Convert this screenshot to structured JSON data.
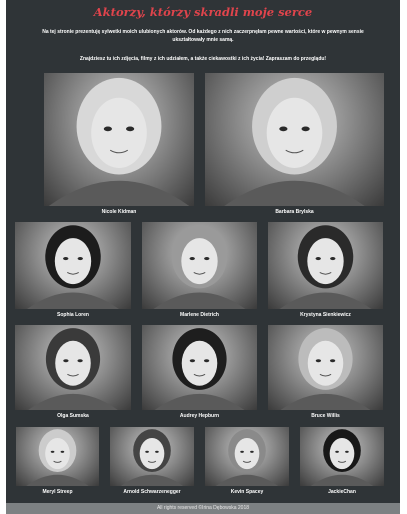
{
  "header": {
    "title": "Aktorzy, którzy skradli moje serce",
    "intro_line_1": "Na tej stronie prezentuję sylwetki moich ulubionych aktorów. Od każdego z nich zaczerpnęłam pewne wartości, które w pewnym sensie ukształtowały mnie samą.",
    "intro_line_2": "Znajdziesz tu ich zdjęcia, filmy z ich udziałem, a także ciekawostki z ich życia! Zapraszam do przeglądu!"
  },
  "actors": [
    {
      "name": "Nicole Kidman",
      "icon": "portrait-photo",
      "hair": "#d8d8d8"
    },
    {
      "name": "Barbara Brylska",
      "icon": "portrait-photo",
      "hair": "#cfcfcf"
    },
    {
      "name": "Sophia Loren",
      "icon": "portrait-photo",
      "hair": "#1c1c1c"
    },
    {
      "name": "Marlene Dietrich",
      "icon": "portrait-photo",
      "hair": "#9a9a9a"
    },
    {
      "name": "Krystyna Sienkiewicz",
      "icon": "portrait-photo",
      "hair": "#2a2a2a"
    },
    {
      "name": "Olga Sumska",
      "icon": "portrait-photo",
      "hair": "#3a3a3a"
    },
    {
      "name": "Audrey Hepburn",
      "icon": "portrait-photo",
      "hair": "#1e1e1e"
    },
    {
      "name": "Bruce Willis",
      "icon": "portrait-photo",
      "hair": "#bcbcbc"
    },
    {
      "name": "Meryl Streep",
      "icon": "portrait-photo",
      "hair": "#cccccc"
    },
    {
      "name": "Arnold Schwarzenegger",
      "icon": "portrait-photo",
      "hair": "#444444"
    },
    {
      "name": "Kevin Spacey",
      "icon": "portrait-photo",
      "hair": "#8a8a8a"
    },
    {
      "name": "JackieChan",
      "icon": "portrait-photo",
      "hair": "#181818"
    }
  ],
  "footer": {
    "text": "All rights reserved ©Irina Dębowska 2018"
  }
}
